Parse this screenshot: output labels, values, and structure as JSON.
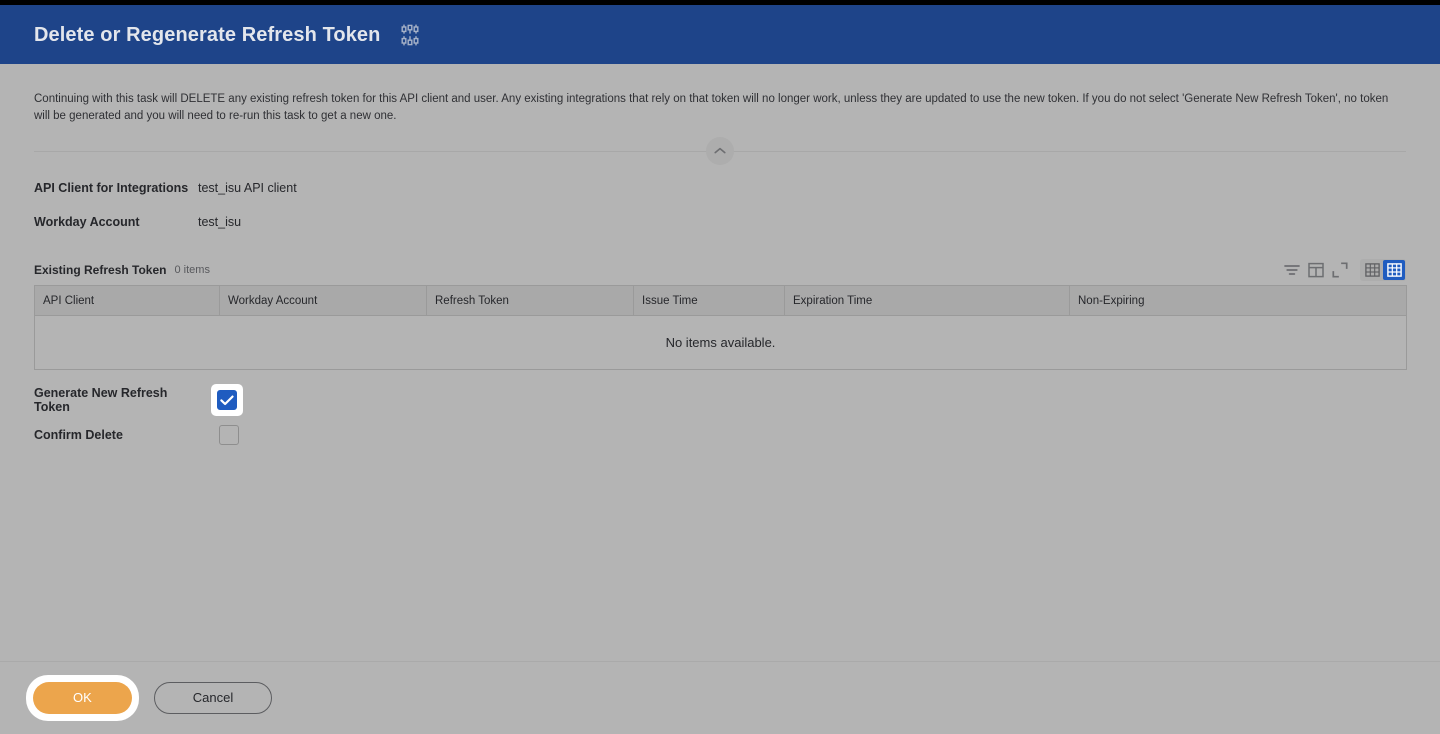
{
  "header": {
    "title": "Delete or Regenerate Refresh Token",
    "icon": "sliders-settings-icon",
    "background_color": "#1e4489"
  },
  "intro": {
    "text": "Continuing with this task will DELETE any existing refresh token for this API client and user. Any existing integrations that rely on that token will no longer work, unless they are updated to use the new token. If you do not select 'Generate New Refresh Token', no token will be generated and you will need to re-run this task to get a new one."
  },
  "collapse": {
    "icon": "chevron-up-icon"
  },
  "fields": [
    {
      "label": "API Client for Integrations",
      "value": "test_isu API client"
    },
    {
      "label": "Workday Account",
      "value": "test_isu"
    }
  ],
  "grid": {
    "caption": "Existing Refresh Token",
    "count": "0 items",
    "toolbar": [
      {
        "name": "filter-icon",
        "label": "Filter"
      },
      {
        "name": "column-config-icon",
        "label": "Configure Columns"
      },
      {
        "name": "expand-icon",
        "label": "Expand"
      }
    ],
    "view_toggles": [
      {
        "name": "grid-view-icon",
        "label": "Grid View",
        "active": false
      },
      {
        "name": "table-view-icon",
        "label": "Table View",
        "active": true
      }
    ],
    "columns": [
      "API Client",
      "Workday Account",
      "Refresh Token",
      "Issue Time",
      "Expiration Time",
      "Non-Expiring"
    ],
    "rows": [],
    "empty_message": "No items available."
  },
  "checkboxes": [
    {
      "label": "Generate New Refresh Token",
      "checked": true,
      "focused": true
    },
    {
      "label": "Confirm Delete",
      "checked": false,
      "focused": false
    }
  ],
  "footer": {
    "ok_label": "OK",
    "cancel_label": "Cancel",
    "ok_color": "#eca54c"
  }
}
